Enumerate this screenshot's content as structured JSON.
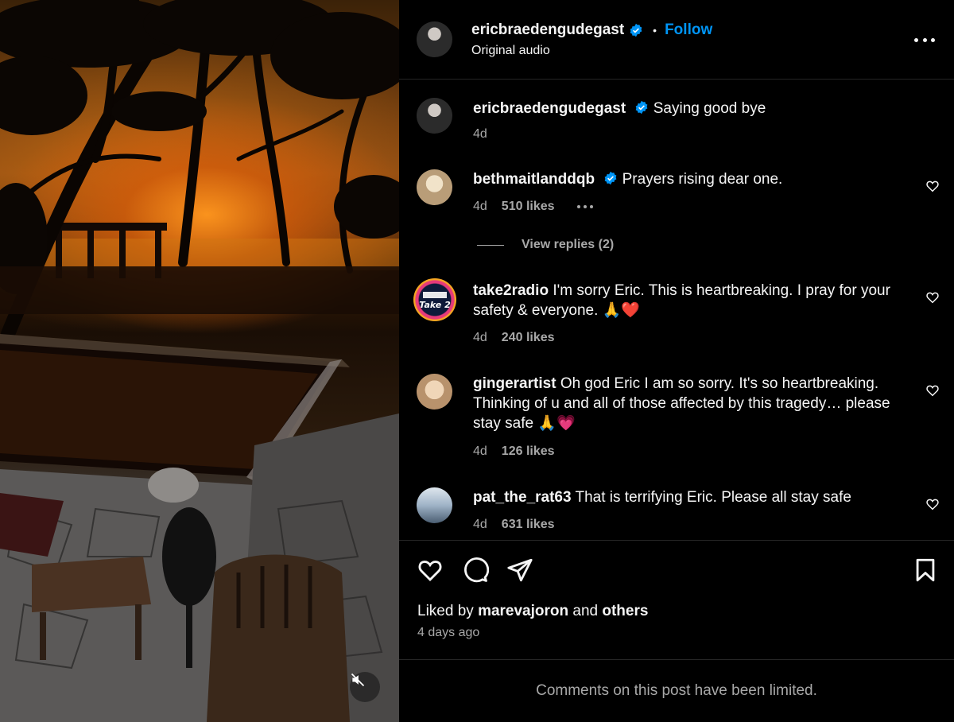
{
  "post": {
    "author": "ericbraedengudegast",
    "follow_label": "Follow",
    "audio": "Original audio",
    "caption": "Saying good bye",
    "caption_age": "4d"
  },
  "comments": [
    {
      "user": "bethmaitlanddqb",
      "verified": true,
      "text": "Prayers rising dear one.",
      "age": "4d",
      "likes": "510 likes",
      "avatar_color": "#c8b89a"
    },
    {
      "user": "take2radio",
      "verified": false,
      "text": "I'm sorry Eric. This is heartbreaking. I pray for your safety & everyone. 🙏❤️",
      "age": "4d",
      "likes": "240 likes",
      "avatar_color": "#1e3a8a"
    },
    {
      "user": "gingerartist",
      "verified": false,
      "text": "Oh god Eric I am so sorry. It's so heartbreaking. Thinking of u and all of those affected by this tragedy… please stay safe 🙏💗",
      "age": "4d",
      "likes": "126 likes",
      "avatar_color": "#c9a07a"
    },
    {
      "user": "pat_the_rat63",
      "verified": false,
      "text": "That is terrifying Eric. Please all stay safe",
      "age": "4d",
      "likes": "631 likes",
      "avatar_color": "#6a7f96"
    }
  ],
  "view_replies": "View replies (2)",
  "liked_by": {
    "prefix": "Liked by",
    "user": "marevajoron",
    "joiner": "and",
    "others": "others"
  },
  "post_age": "4 days ago",
  "footer_note": "Comments on this post have been limited.",
  "icons": [
    "verified-badge-icon",
    "more-options-icon",
    "heart-icon",
    "comment-icon",
    "share-icon",
    "bookmark-icon",
    "mute-icon"
  ],
  "colors": {
    "accent": "#0095f6",
    "background": "#000000",
    "muted_text": "#a8a8a8",
    "divider": "#262626"
  }
}
